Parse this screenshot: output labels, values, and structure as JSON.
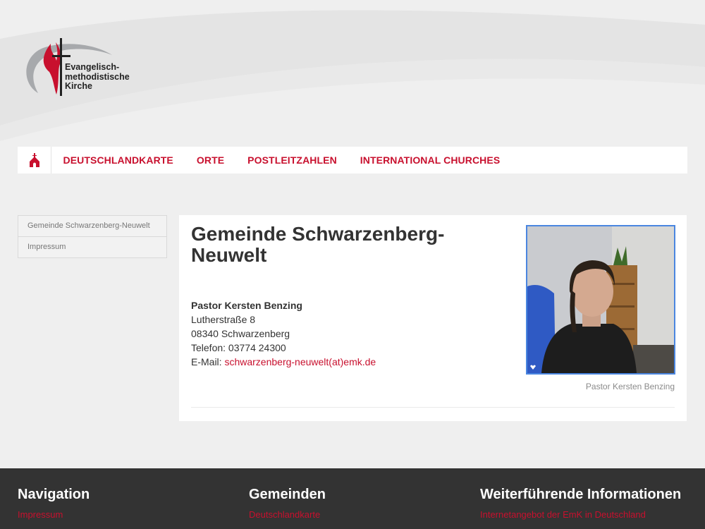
{
  "logo": {
    "lines": [
      "Evangelisch-",
      "methodistische",
      "Kirche"
    ]
  },
  "nav": {
    "home_icon": "church-icon",
    "items": [
      "DEUTSCHLANDKARTE",
      "ORTE",
      "POSTLEITZAHLEN",
      "INTERNATIONAL CHURCHES"
    ]
  },
  "sidebar": {
    "items": [
      "Gemeinde Schwarzenberg-Neuwelt",
      "Impressum"
    ]
  },
  "main": {
    "title": "Gemeinde Schwarzenberg-Neuwelt",
    "contact": {
      "name": "Pastor Kersten Benzing",
      "street": "Lutherstraße 8",
      "city": "08340 Schwarzenberg",
      "phone": "Telefon: 03774 24300",
      "email_label": "E-Mail: ",
      "email": "schwarzenberg-neuwelt(at)emk.de"
    },
    "photo_caption": "Pastor Kersten Benzing",
    "photo_icon": "heart-icon"
  },
  "footer": {
    "col1": {
      "heading": "Navigation",
      "link": "Impressum"
    },
    "col2": {
      "heading": "Gemeinden",
      "link": "Deutschlandkarte"
    },
    "col3": {
      "heading": "Weiterführende Informationen",
      "link": "Internetangebot der EmK in Deutschland"
    }
  },
  "colors": {
    "accent": "#c8102e",
    "background": "#efefef",
    "footer": "#333333",
    "photo_border": "#4a86e0"
  }
}
